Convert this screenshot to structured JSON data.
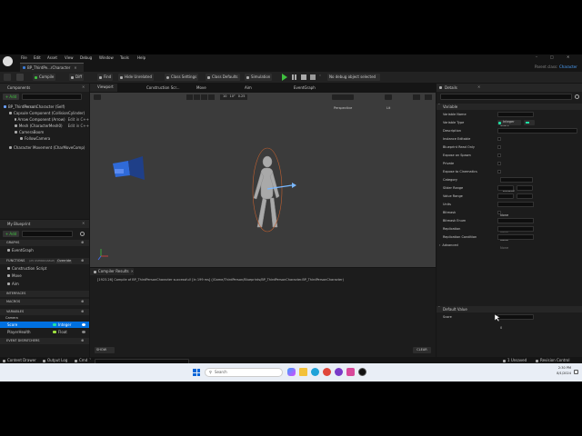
{
  "window": {
    "logo": "unreal-logo",
    "menu": [
      "File",
      "Edit",
      "Asset",
      "View",
      "Debug",
      "Window",
      "Tools",
      "Help"
    ],
    "tab_label": "BP_ThirdPe...rCharacter",
    "parent_class_label": "Parent class:",
    "parent_class_value": "Character"
  },
  "toolbar": {
    "compile": "Compile",
    "diff": "Diff",
    "find": "Find",
    "hide_unrelated": "Hide Unrelated",
    "class_settings": "Class Settings",
    "class_defaults": "Class Defaults",
    "simulation": "Simulation",
    "debug_object": "No debug object selected"
  },
  "components": {
    "title": "Components",
    "add": "+ Add",
    "search_placeholder": "Search",
    "items": [
      {
        "label": "BP_ThirdPersonCharacter (Self)",
        "edit": ""
      },
      {
        "label": "Capsule Component (CollisionCylinder)",
        "edit": ""
      },
      {
        "label": "Arrow Component (Arrow)",
        "edit": "Edit in C++"
      },
      {
        "label": "Mesh (CharacterMesh0)",
        "edit": "Edit in C++"
      },
      {
        "label": "CameraBoom",
        "edit": ""
      },
      {
        "label": "FollowCamera",
        "edit": ""
      },
      {
        "label": "Character Movement (CharMoveComp)",
        "edit": ""
      }
    ]
  },
  "my_blueprint": {
    "title": "My Blueprint",
    "add": "+ Add",
    "search_placeholder": "Search",
    "graphs": "GRAPHS",
    "event_graph": "EventGraph",
    "functions": "FUNCTIONS",
    "functions_count": "(25 OVERRIDABLE)",
    "override": "Override",
    "function_items": [
      "Construction Script",
      "Move",
      "Aim"
    ],
    "interfaces": "INTERFACES",
    "macros": "MACROS",
    "variables": "VARIABLES",
    "var_category": "Camera",
    "var_rows": [
      {
        "name": "Score",
        "type": "Integer",
        "color": "#1fe0a4",
        "selected": true
      },
      {
        "name": "PlayerHealth",
        "type": "Float",
        "color": "#9ee03f",
        "selected": false
      }
    ],
    "dispatchers": "EVENT DISPATCHERS"
  },
  "editor_tabs": [
    "Viewport",
    "Construction Scr...",
    "Move",
    "Aim",
    "EventGraph"
  ],
  "viewport": {
    "perspective": "Perspective",
    "lit": "Lit",
    "snap_grid": "10",
    "snap_rot": "10°",
    "snap_scale": "0.25"
  },
  "compiler": {
    "title": "Compiler Results",
    "message": "[1923.26] Compile of BP_ThirdPersonCharacter successful! [in 199 ms] (/Game/ThirdPerson/Blueprints/BP_ThirdPersonCharacter.BP_ThirdPersonCharacter)",
    "show": "SHOW",
    "clear": "CLEAR"
  },
  "details": {
    "title": "Details",
    "search_placeholder": "Search",
    "section_variable": "Variable",
    "rows": [
      {
        "label": "Variable Name",
        "value": "Score",
        "kind": "text"
      },
      {
        "label": "Variable Type",
        "value": "Integer",
        "kind": "type"
      },
      {
        "label": "Description",
        "value": "",
        "kind": "wide"
      },
      {
        "label": "Instance Editable",
        "value": "",
        "kind": "check"
      },
      {
        "label": "Blueprint Read Only",
        "value": "",
        "kind": "check"
      },
      {
        "label": "Expose on Spawn",
        "value": "",
        "kind": "check"
      },
      {
        "label": "Private",
        "value": "",
        "kind": "check"
      },
      {
        "label": "Expose to Cinematics",
        "value": "",
        "kind": "check"
      },
      {
        "label": "Category",
        "value": "Default",
        "kind": "select"
      },
      {
        "label": "Slider Range",
        "value": "",
        "kind": "pair"
      },
      {
        "label": "Value Range",
        "value": "",
        "kind": "pair"
      },
      {
        "label": "Units",
        "value": "None",
        "kind": "select"
      },
      {
        "label": "Bitmask",
        "value": "",
        "kind": "check"
      },
      {
        "label": "Bitmask Enum",
        "value": "None",
        "kind": "select"
      },
      {
        "label": "Replication",
        "value": "None",
        "kind": "select"
      },
      {
        "label": "Replication Condition",
        "value": "None",
        "kind": "select"
      }
    ],
    "advanced": "Advanced",
    "section_default": "Default Value",
    "default_label": "Score",
    "default_value": "0"
  },
  "status": {
    "content_drawer": "Content Drawer",
    "output_log": "Output Log",
    "cmd": "Cmd",
    "cmd_placeholder": "Enter Console Command",
    "unsaved": "1 Unsaved",
    "revision_control": "Revision Control"
  },
  "taskbar": {
    "search_placeholder": "Search",
    "time": "2:30 PM",
    "date": "8/1/2024"
  },
  "colors": {
    "accent_blue": "#0070e0",
    "play_green": "#3fbf3f",
    "integer_pin": "#1fe0a4",
    "float_pin": "#9ee03f"
  }
}
